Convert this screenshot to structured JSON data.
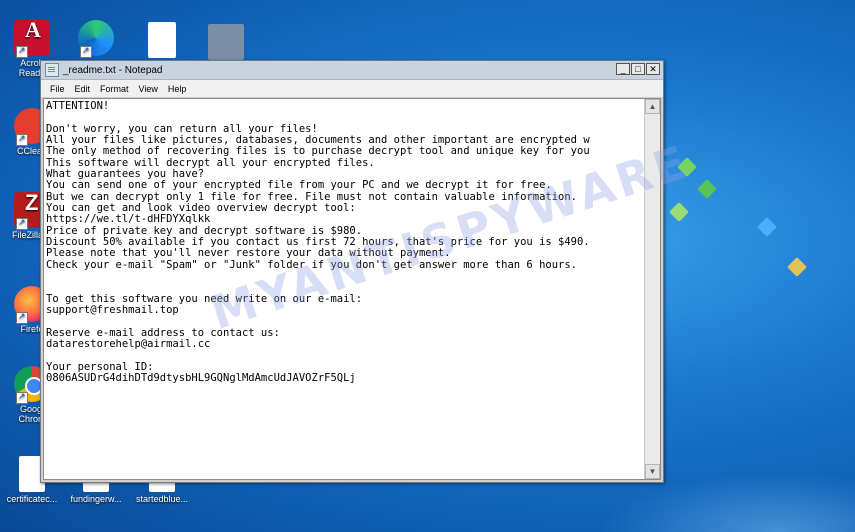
{
  "desktop": {
    "icons": [
      {
        "label": "Acrob\nReade",
        "icon": "acrobat-icon"
      },
      {
        "label": "",
        "icon": "edge-icon"
      },
      {
        "label": "",
        "icon": "file-icon"
      },
      {
        "label": "",
        "icon": "folder-icon"
      },
      {
        "label": "CClean",
        "icon": "ccleaner-icon"
      },
      {
        "label": "FileZilla C",
        "icon": "filezilla-icon"
      },
      {
        "label": "Firefo",
        "icon": "firefox-icon"
      },
      {
        "label": "Googl\nChrom",
        "icon": "chrome-icon"
      },
      {
        "label": "certificatec...",
        "icon": "document-icon"
      },
      {
        "label": "fundingerw...",
        "icon": "document-icon"
      },
      {
        "label": "startedblue...",
        "icon": "document-icon"
      }
    ]
  },
  "window": {
    "title": "_readme.txt - Notepad",
    "controls": {
      "minimize": "_",
      "maximize": "□",
      "close": "✕"
    },
    "menu": [
      "File",
      "Edit",
      "Format",
      "View",
      "Help"
    ],
    "body_text": "ATTENTION!\n\nDon't worry, you can return all your files!\nAll your files like pictures, databases, documents and other important are encrypted w\nThe only method of recovering files is to purchase decrypt tool and unique key for you\nThis software will decrypt all your encrypted files.\nWhat guarantees you have?\nYou can send one of your encrypted file from your PC and we decrypt it for free.\nBut we can decrypt only 1 file for free. File must not contain valuable information.\nYou can get and look video overview decrypt tool:\nhttps://we.tl/t-dHFDYXqlkk\nPrice of private key and decrypt software is $980.\nDiscount 50% available if you contact us first 72 hours, that's price for you is $490.\nPlease note that you'll never restore your data without payment.\nCheck your e-mail \"Spam\" or \"Junk\" folder if you don't get answer more than 6 hours.\n\n\nTo get this software you need write on our e-mail:\nsupport@freshmail.top\n\nReserve e-mail address to contact us:\ndatarestorehelp@airmail.cc\n\nYour personal ID:\n0806ASUDrG4dihDTd9dtysbHL9GQNglMdAmcUdJAVOZrF5QLj"
  },
  "watermark": "MYANTISPYWARE"
}
